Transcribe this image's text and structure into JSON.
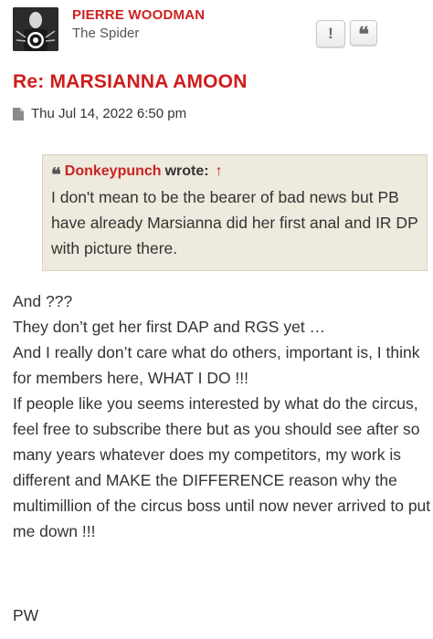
{
  "post": {
    "author": {
      "username": "PIERRE WOODMAN",
      "rank": "The Spider",
      "avatar_icon": "spider-avatar-icon"
    },
    "actions": {
      "report_label": "!",
      "quote_label": "❝"
    },
    "title": "Re: MARSIANNA AMOON",
    "meta": {
      "icon": "post-document-icon",
      "timestamp": "Thu Jul 14, 2022 6:50 pm"
    },
    "quote": {
      "mark": "❝",
      "author": "Donkeypunch",
      "wrote": "wrote:",
      "arrow": "↑",
      "text": "I don't mean to be the bearer of bad news but PB have already Marsianna did her first anal and IR DP with picture there."
    },
    "body_lines": [
      "And ???",
      "They don’t get her first DAP and RGS yet …",
      "And I really don’t care what do others, important is, I think for members here, WHAT I DO !!!",
      "If people like you seems interested by what do the circus, feel free to subscribe there but as you should see after so many years whatever does my competitors, my work is different and MAKE the DIFFERENCE reason why the multimillion of the circus boss until now never arrived to put me down !!!"
    ],
    "signature": "PW"
  },
  "colors": {
    "accent_red": "#cc2222",
    "quote_bg": "#eeeadd",
    "text": "#333333"
  }
}
